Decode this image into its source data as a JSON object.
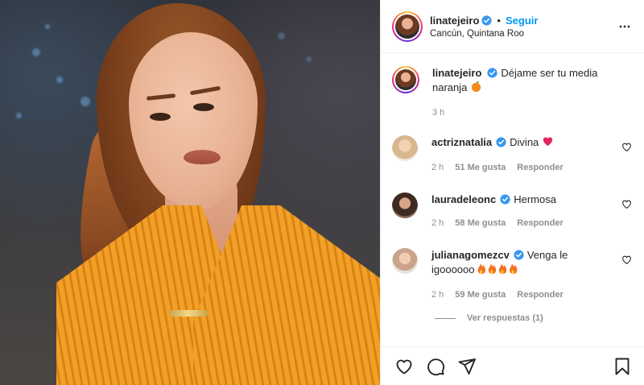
{
  "post": {
    "author": {
      "username": "linatejeiro",
      "verified": true,
      "follow_label": "Seguir",
      "separator": "•",
      "location": "Cancún, Quintana Roo"
    },
    "more_icon": "more-horizontal-icon",
    "caption": {
      "username": "linatejeiro",
      "text": "Déjame ser tu media naranja",
      "emoji": "orange-fruit-icon",
      "time": "3 h"
    },
    "comments": [
      {
        "username": "actriznatalia",
        "text": "Divina",
        "emoji": "red-heart-icon",
        "time": "2 h",
        "likes": "51 Me gusta",
        "reply_label": "Responder",
        "avatar_color": "#d8b690"
      },
      {
        "username": "lauradeleonc",
        "text": "Hermosa",
        "emoji": "",
        "time": "2 h",
        "likes": "58 Me gusta",
        "reply_label": "Responder",
        "avatar_color": "#5a3a2a"
      },
      {
        "username": "julianagomezcv",
        "text": "Venga le igoooooo",
        "emoji": "fire-icon x4",
        "time": "2 h",
        "likes": "59 Me gusta",
        "reply_label": "Responder",
        "avatar_color": "#c9a48a"
      }
    ],
    "view_replies_label": "Ver respuestas (1)",
    "actions": [
      "heart-icon",
      "comment-icon",
      "share-icon",
      "bookmark-icon"
    ]
  },
  "colors": {
    "link_blue": "#0095f6",
    "verified_blue": "#3897f0",
    "text": "#262626",
    "muted": "#8e8e8e"
  }
}
